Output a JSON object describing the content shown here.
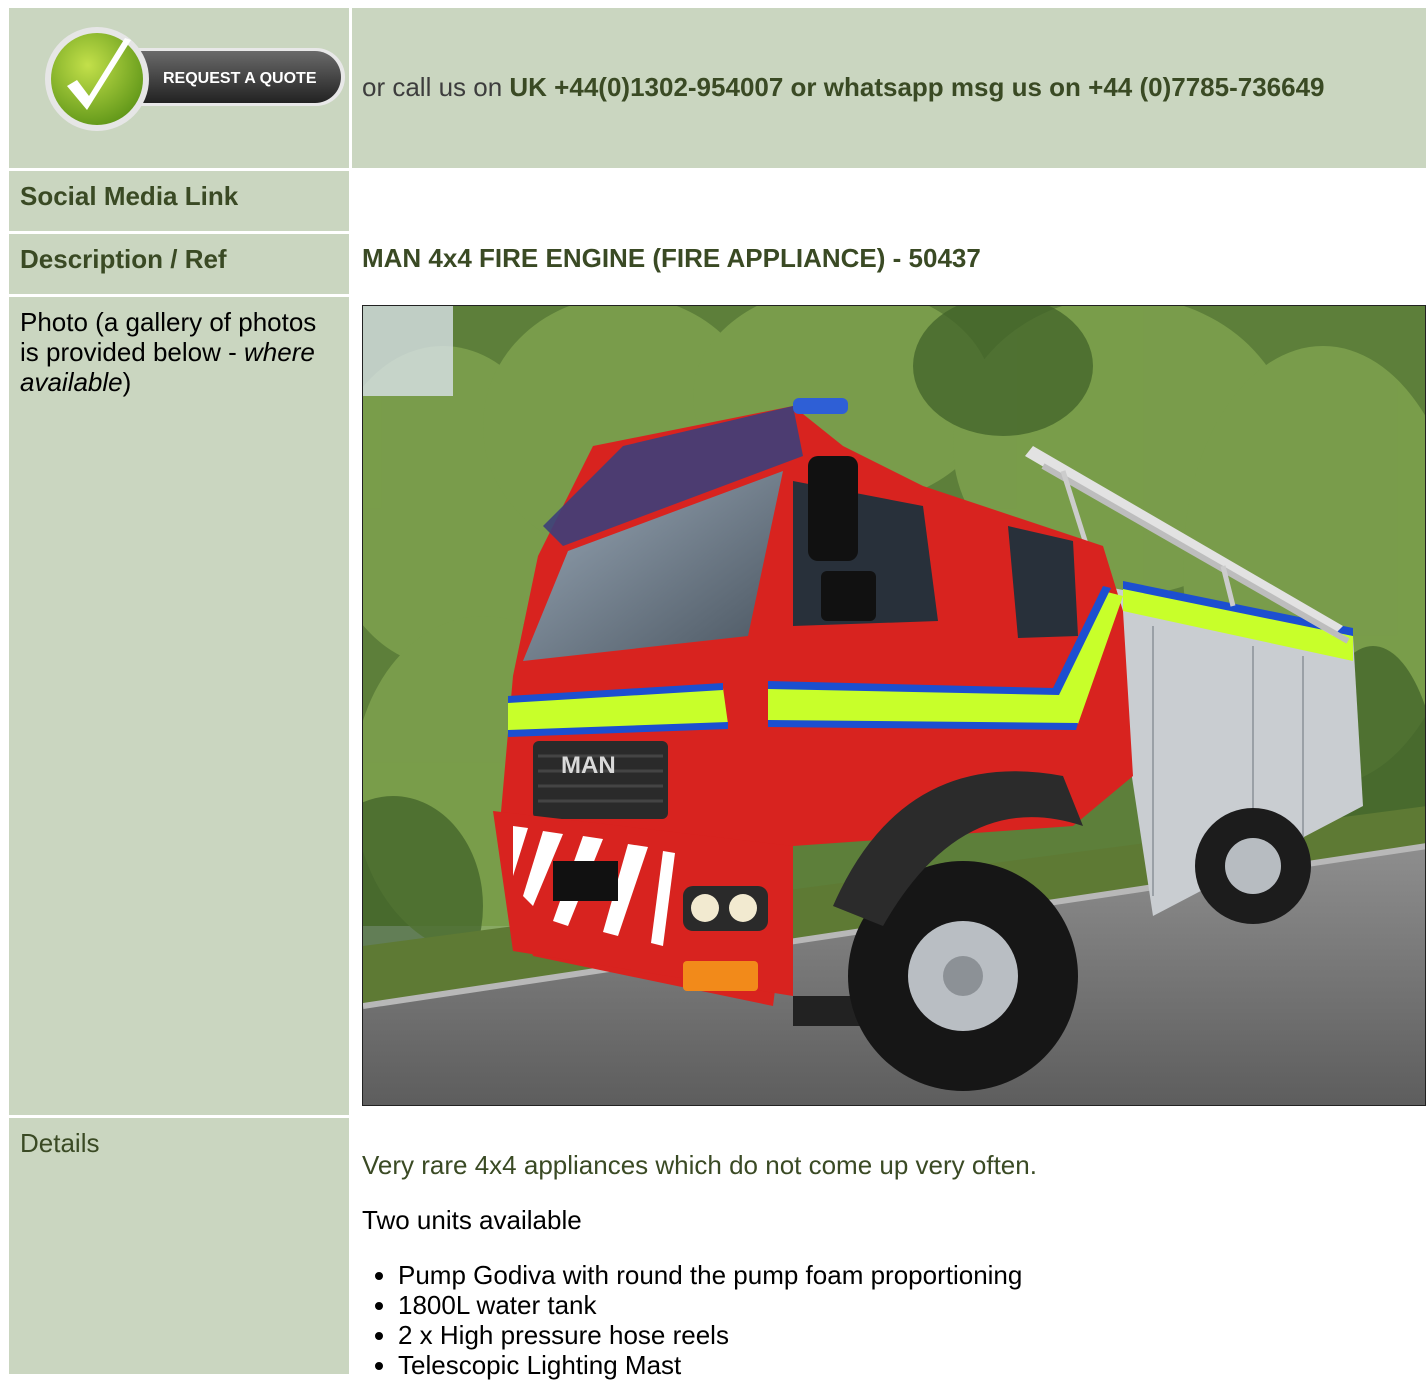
{
  "header": {
    "quote_button_label": "REQUEST A QUOTE",
    "call_prefix": "or call us on ",
    "call_numbers": "UK +44(0)1302-954007 or whatsapp msg us on +44 (0)7785-736649"
  },
  "labels": {
    "social_media": "Social Media Link",
    "description_ref": "Description / Ref",
    "photo_prefix": "Photo (a gallery of photos is provided below - ",
    "photo_italic": "where available",
    "photo_suffix": ")",
    "details": "Details"
  },
  "listing": {
    "title": "MAN 4x4 FIRE ENGINE (FIRE APPLIANCE) - 50437",
    "intro": "Very rare 4x4 appliances which do not come up very often.",
    "units": "Two units available",
    "features": [
      "Pump Godiva with round the pump foam proportioning",
      "1800L water tank",
      "2 x High pressure hose reels",
      "Telescopic Lighting Mast"
    ]
  },
  "photo": {
    "alt": "Red MAN 4x4 fire engine parked on road with trees behind",
    "grille_text": "MAN"
  },
  "colors": {
    "panel_bg": "#cad6c0",
    "label_green": "#3a4a24",
    "truck_red": "#d8231f",
    "hi_vis": "#c8ff2a",
    "stripe_blue": "#1c4fd0"
  }
}
